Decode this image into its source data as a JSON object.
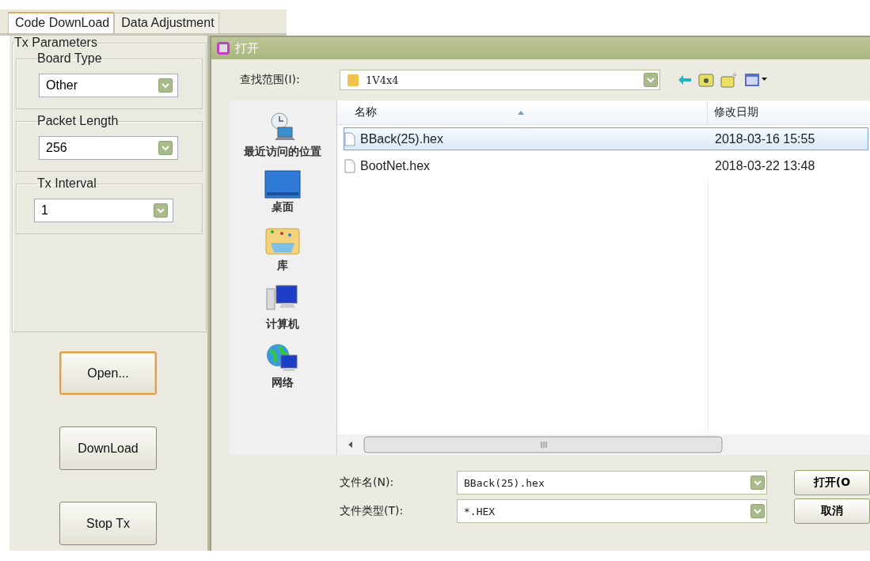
{
  "tabs": [
    {
      "label": "Code DownLoad",
      "selected": true
    },
    {
      "label": "Data Adjustment",
      "selected": false
    }
  ],
  "tx_parameters": {
    "title": "Tx Parameters",
    "groups": [
      {
        "title": "Board Type",
        "value": "Other"
      },
      {
        "title": "Packet Length",
        "value": "256"
      },
      {
        "title": "Tx Interval",
        "value": "1"
      }
    ]
  },
  "buttons": [
    {
      "label": "Open...",
      "focused": true
    },
    {
      "label": "DownLoad",
      "focused": false
    },
    {
      "label": "Stop Tx",
      "focused": false
    }
  ],
  "dialog": {
    "title": "打开",
    "look_in": {
      "label": "查找范围(I):",
      "value": "1V4x4"
    },
    "places": [
      {
        "label": "最近访问的位置",
        "kind": "recent"
      },
      {
        "label": "桌面",
        "kind": "desktop"
      },
      {
        "label": "库",
        "kind": "library"
      },
      {
        "label": "计算机",
        "kind": "computer"
      },
      {
        "label": "网络",
        "kind": "network"
      }
    ],
    "columns": [
      "名称",
      "修改日期"
    ],
    "files": [
      {
        "name": "BBack(25).hex",
        "modified": "2018-03-16 15:55",
        "selected": true
      },
      {
        "name": "BootNet.hex",
        "modified": "2018-03-22 13:48",
        "selected": false
      }
    ],
    "file_name": {
      "label": "文件名(N):",
      "value": "BBack(25).hex"
    },
    "file_type": {
      "label": "文件类型(T):",
      "value": "*.HEX"
    },
    "actions": [
      "打开(O",
      "取消"
    ]
  }
}
